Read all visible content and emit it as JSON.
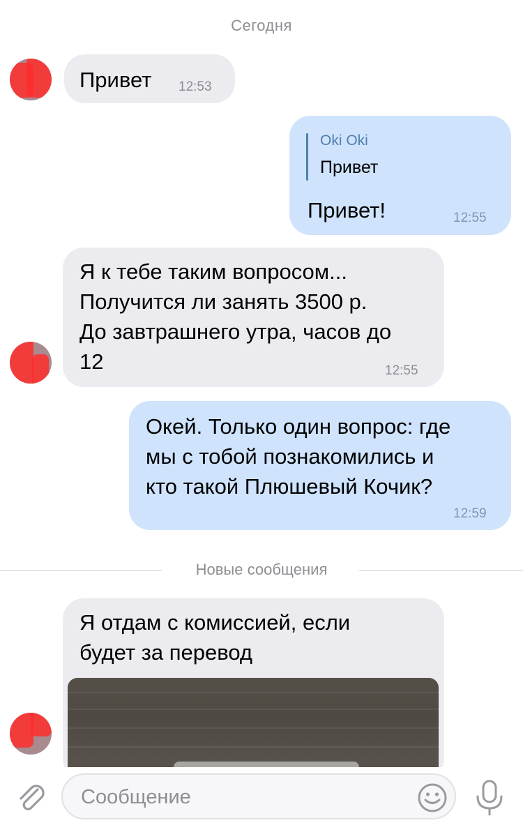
{
  "date_separator": "Сегодня",
  "messages": [
    {
      "direction": "incoming",
      "text": "Привет",
      "time": "12:53"
    },
    {
      "direction": "outgoing",
      "reply_author": "Oki Oki",
      "reply_text": "Привет",
      "text": "Привет!",
      "time": "12:55"
    },
    {
      "direction": "incoming",
      "text": "Я к тебе таким вопросом...\nПолучится ли занять 3500 р.\nДо завтрашнего утра, часов до\n12",
      "time": "12:55"
    },
    {
      "direction": "outgoing",
      "text": "Окей. Только один вопрос: где\nмы с тобой познакомились и\nкто такой Плюшевый Кочик?",
      "time": "12:59"
    },
    {
      "direction": "incoming",
      "text": "Я отдам с комиссией, если\nбудет за перевод",
      "has_photo": true
    }
  ],
  "new_messages_separator": "Новые сообщения",
  "composer": {
    "placeholder": "Сообщение"
  },
  "colors": {
    "incoming_bubble": "#ebebf0",
    "outgoing_bubble": "#cfe3fd",
    "accent": "#4f7fae",
    "redaction": "#ff2d2d"
  },
  "icons": [
    "paperclip-icon",
    "emoji-icon",
    "microphone-icon"
  ]
}
